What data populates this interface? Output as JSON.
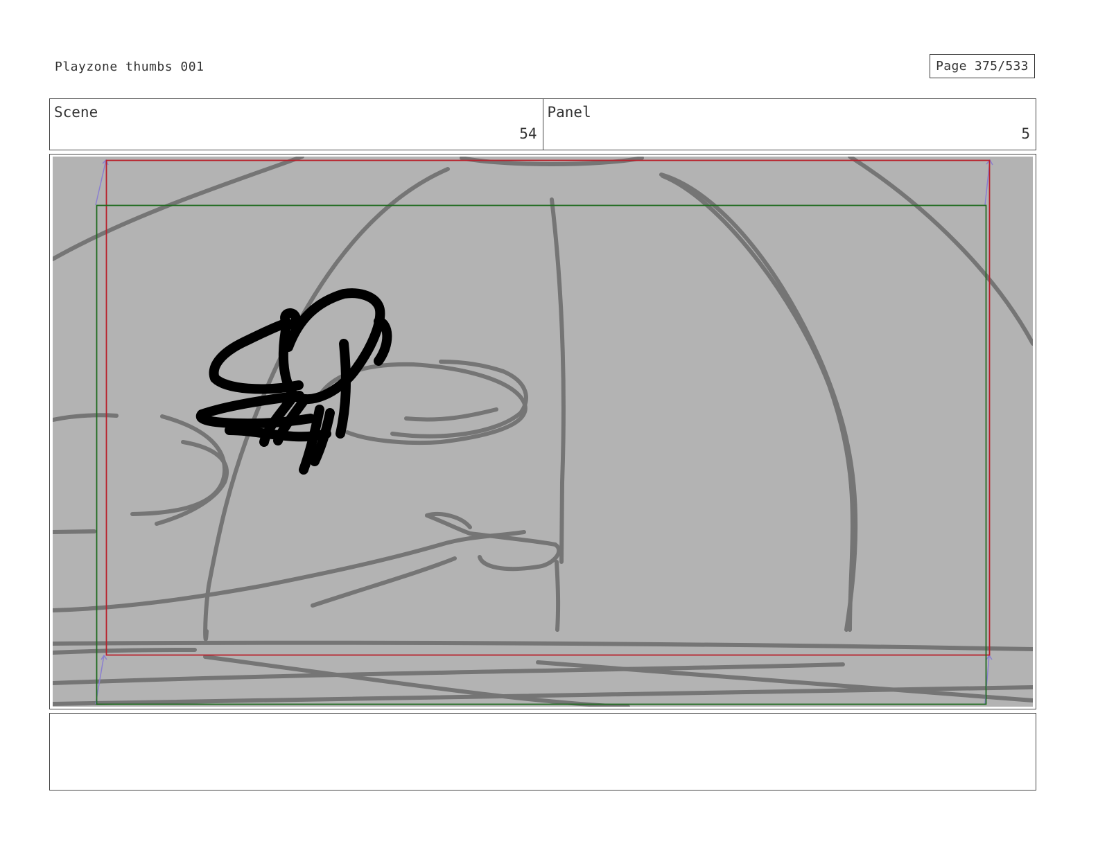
{
  "header": {
    "title": "Playzone thumbs 001",
    "page": "Page 375/533"
  },
  "info": {
    "scene_label": "Scene",
    "scene_value": "54",
    "panel_label": "Panel",
    "panel_value": "5"
  },
  "colors": {
    "panel_background": "#b3b3b3",
    "sketch_stroke": "#757575",
    "ink_stroke": "#000000",
    "action_safe_frame": "#b8202b",
    "title_safe_frame": "#1f6b1f",
    "camera_arrows": "#8a7fd0"
  },
  "notes": {
    "text": ""
  }
}
